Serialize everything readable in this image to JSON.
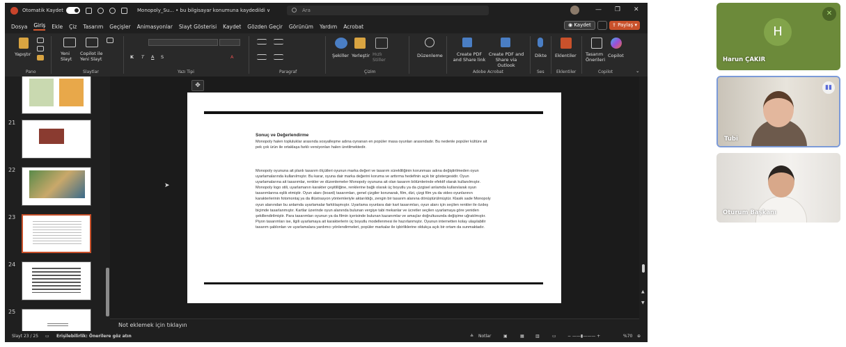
{
  "window": {
    "autosave_label": "Otomatik Kaydet",
    "doc_title": "Monopoly_Su...  •  bu bilgisayar konumuna kaydedildi ∨",
    "search_placeholder": "Ara"
  },
  "menu": [
    "Dosya",
    "Giriş",
    "Ekle",
    "Çiz",
    "Tasarım",
    "Geçişler",
    "Animasyonlar",
    "Slayt Gösterisi",
    "Kaydet",
    "Gözden Geçir",
    "Görünüm",
    "Yardım",
    "Acrobat"
  ],
  "menu_active_index": 1,
  "actions": {
    "save": "Kaydet",
    "share": "Paylaş"
  },
  "ribbon": {
    "paste": "Yapıştır",
    "new_slide": "Yeni Slayt",
    "copilot_new": "Copilot ile Yeni Slayt",
    "shapes": "Şekiller",
    "arrange": "Yerleştir",
    "quick_styles": "Hızlı Stiller",
    "editing": "Düzenleme",
    "create_pdf": "Create PDF and Share link",
    "create_pdf_outlook": "Create PDF and Share via Outlook",
    "dictate": "Dikte",
    "addins": "Eklentiler",
    "designer": "Tasarım Önerileri",
    "copilot": "Copilot",
    "groups": [
      "Pano",
      "Slaytlar",
      "Yazı Tipi",
      "Paragraf",
      "Çizim",
      "Adobe Acrobat",
      "Ses",
      "Eklentiler",
      "Copilot"
    ]
  },
  "thumbnails": [
    {
      "number": "",
      "selected": false
    },
    {
      "number": "21",
      "selected": false
    },
    {
      "number": "22",
      "selected": false
    },
    {
      "number": "23",
      "selected": true
    },
    {
      "number": "24",
      "selected": false
    },
    {
      "number": "25",
      "selected": false
    }
  ],
  "slide": {
    "title": "Sonuç ve Değerlendirme",
    "para1": "Monopoly halen topluluklar arasında sosyalleşme adına oynanan en popüler masa oyunları arasındadır. Bu nedenle popüler kültüre ait pek çok ürün ile ortaklaşa farklı versiyonları halen üretilmektedir.",
    "para2": "Monopoly oyununa ait planlı tasarım ölçütleri oyunun marka değeri ve tasarım sürekliliğinin korunması adına değiştirilmeden oyun uyarlamalarında kullanılmıştır. Bu karar, oyuna dair marka değerini koruma ve arttırma hedefinin açık bir göstergesidir. Oyun uyarlamalarına ait tasarımlar, renkler ve düzenlemeler Monopoly oyununa ait olan tasarım bölümlerinde efektif olarak kullanılmıştır. Monopoly logo stili, uyarlamanın karakter çeşitliliğine, renklerine bağlı olarak üç boyutlu ya da çizgisel anlamda kullanılarak oyun tasarımlarına eşlik etmiştir. Oyun alanı (board) tasarımları, genel çizgiler korunarak, film, dizi, çizgi film ya da video oyunlarının karakterlerinin fotomontaj ya da illüstrasyon yöntemleriyle aktarıldığı, zengin bir tasarım alanına dönüştürülmüştür. Klasik sade Monopoly oyun alanından bu anlamda uyarlamalar farklılaşmıştır. Uyarlama oyunlara dair kart tasarımları, oyun alanı için seçilen renkler ile özdeş biçimde tasarlanmıştır. Kartlar üzerinde oyun alanında bulunan vergiye tabi mekanlar ve ücretler seçilen uyarlamaya göre yeniden şekillendirilmiştir. Para tasarımları oyunun ya da filmin içerisinde bulunan kazanımlar ve amaçlar doğrultusunda değişime uğratılmıştır. Piyon tasarımları ise, ilgili uyarlamaya ait karakterlerin üç boyutlu modellenmesi ile hazırlanmıştır. Oyunun internetten kolay ulaşılabilir tasarım şablonları ve uyarlamalara yardımcı yönlendirmeleri, popüler markalar ile işbirliklerine oldukça açık bir ortam da sunmaktadır."
  },
  "notes_placeholder": "Not eklemek için tıklayın",
  "status": {
    "slide_counter": "Slayt 23 / 25",
    "accessibility": "Erişilebilirlik: Önerilere göz atın",
    "notes": "Notlar",
    "zoom": "%70"
  },
  "participants": [
    {
      "name": "Harun ÇAKIR",
      "initial": "H",
      "muted": true
    },
    {
      "name": "Tubi",
      "speaking": true
    },
    {
      "name": "Oturum Başkanı"
    }
  ],
  "colors": {
    "accent": "#c9512b",
    "teams_tile": "#6c8a3a"
  }
}
